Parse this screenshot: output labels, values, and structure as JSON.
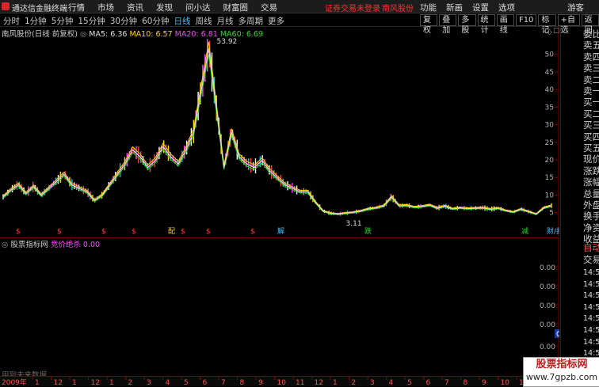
{
  "titlebar": {
    "app_name": "通达信金融终端",
    "menus": [
      "行情",
      "市场",
      "资讯",
      "发现",
      "问小达",
      "财富圈",
      "交易"
    ],
    "warning": "证券交易未登录",
    "stock": "南风股份",
    "right_menus": [
      "功能",
      "新画",
      "设置",
      "选项"
    ],
    "guest": "游客"
  },
  "period_bar": {
    "periods": [
      "分时",
      "1分钟",
      "5分钟",
      "15分钟",
      "30分钟",
      "60分钟",
      "日线",
      "周线",
      "月线",
      "多周期",
      "更多"
    ],
    "active": "日线",
    "tools": [
      "复权",
      "叠加",
      "多股",
      "统计",
      "画线",
      "F10",
      "标记",
      "+自选",
      "返回"
    ]
  },
  "chart_legend": {
    "title": "南风股份(日线 前复权)",
    "ma5": "MA5: 6.36",
    "ma10": "MA10: 6.57",
    "ma20": "MA20: 6.81",
    "ma60": "MA60: 6.69"
  },
  "colors": {
    "ma5": "#e0e0e0",
    "ma10": "#ffd400",
    "ma20": "#ff44ff",
    "ma60": "#22dd22",
    "up": "#ff3c3c",
    "down": "#22c0c0",
    "border": "#7a0000"
  },
  "annotations": {
    "high": "53.92",
    "low": "3.11"
  },
  "event_markers": [
    "$",
    "$",
    "$",
    "$",
    "配",
    "$",
    "$",
    "$",
    "解",
    "跌",
    "减",
    "财/报"
  ],
  "chart_data": {
    "type": "line",
    "title": "南风股份(日线 前复权)",
    "x_start": "2009年",
    "y_ticks": [
      50,
      45,
      40,
      35,
      30,
      25,
      20,
      15,
      10,
      5
    ],
    "ylim": [
      2,
      56
    ],
    "series": [
      {
        "name": "MA5",
        "values": [
          9.5,
          11.5,
          13,
          10.5,
          12.5,
          10,
          12,
          14,
          16,
          13,
          12,
          11,
          8.5,
          10,
          13,
          16,
          19,
          23,
          21,
          18,
          20,
          24,
          21,
          19,
          23,
          28,
          40,
          52,
          35,
          18,
          28,
          21,
          19,
          18,
          20,
          17,
          15,
          13,
          12,
          11,
          11,
          8,
          5.5,
          4.8,
          4.6,
          4.9,
          5.1,
          5.5,
          6.1,
          6.4,
          7,
          9.5,
          7,
          7.1,
          6.6,
          6.8,
          7.2,
          6.3,
          6.9,
          6.1,
          6.4,
          6.2,
          6.3,
          6.4,
          6,
          6.3,
          5.6,
          5.2,
          6,
          5.3,
          4.6,
          6.4,
          7
        ]
      }
    ],
    "indicator": {
      "name": "股票指标网",
      "label": "竞价绝杀",
      "value": "0.00"
    }
  },
  "date_axis": {
    "year": "2009年",
    "labels": [
      "1",
      "12",
      "1",
      "12",
      "1",
      "2",
      "3",
      "4",
      "5",
      "6",
      "7",
      "8",
      "9",
      "10",
      "11",
      "12",
      "1",
      "2",
      "3",
      "4",
      "5",
      "6",
      "7",
      "8",
      "9",
      "10",
      "11"
    ]
  },
  "right_panel": {
    "items": [
      "委比",
      "卖五",
      "卖四",
      "卖三",
      "卖二",
      "卖一",
      "买一",
      "买二",
      "买三",
      "买四",
      "买五",
      "现价",
      "涨跌",
      "涨幅",
      "总量",
      "外盘",
      "换手",
      "净资",
      "收益"
    ],
    "auto": "自动",
    "trade": "交易",
    "times": [
      "14:56",
      "14:56",
      "14:56",
      "14:56",
      "14:56",
      "14:56",
      "14:56",
      "14:56",
      "14:56"
    ],
    "axis_values": [
      "0.00",
      "0.00",
      "0.00",
      "0.00",
      "0.00"
    ],
    "badge": "0.00"
  },
  "footer_note": "用到未来数据",
  "watermark": {
    "line1": "股票指标网",
    "line2": "www.7gpzb.com"
  }
}
